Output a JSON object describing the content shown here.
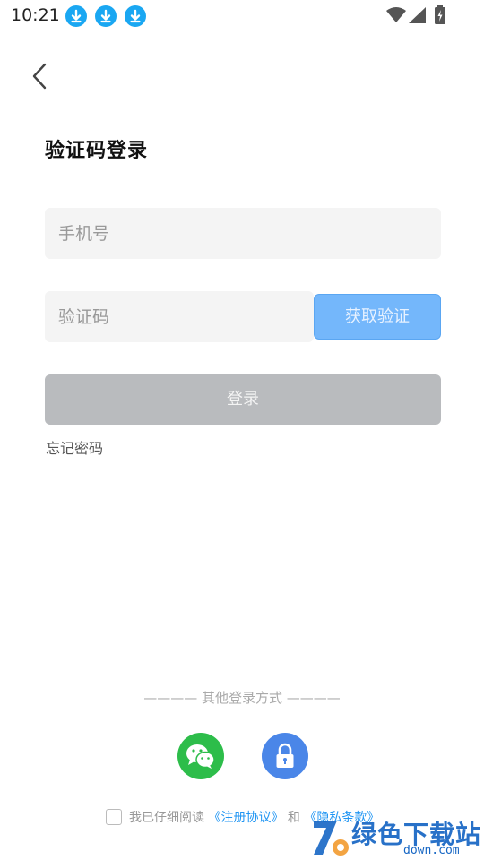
{
  "status_bar": {
    "time": "10:21",
    "icons": [
      "download-badge-icon",
      "download-badge-icon",
      "download-badge-icon",
      "wifi-icon",
      "signal-icon",
      "battery-icon"
    ]
  },
  "header": {
    "back_icon": "chevron-left-icon"
  },
  "title": "验证码登录",
  "phone": {
    "placeholder": "手机号",
    "value": ""
  },
  "code": {
    "placeholder": "验证码",
    "value": "",
    "get_code_label": "获取验证"
  },
  "login_label": "登录",
  "forgot_label": "忘记密码",
  "other_login": {
    "label": "———— 其他登录方式 ————",
    "methods": [
      {
        "name": "wechat",
        "icon": "wechat-icon",
        "color": "#2dbd4a"
      },
      {
        "name": "password",
        "icon": "lock-icon",
        "color": "#4a86e8"
      }
    ]
  },
  "agreement": {
    "prefix": "我已仔细阅读",
    "terms_link": "《注册协议》",
    "and": "和",
    "privacy_link": "《隐私条款》"
  },
  "watermark": {
    "text": "绿色下载站",
    "sub": "down.com"
  },
  "colors": {
    "accent": "#74b7fb",
    "link": "#2196f3",
    "wechat": "#2dbd4a",
    "lock": "#4a86e8"
  }
}
